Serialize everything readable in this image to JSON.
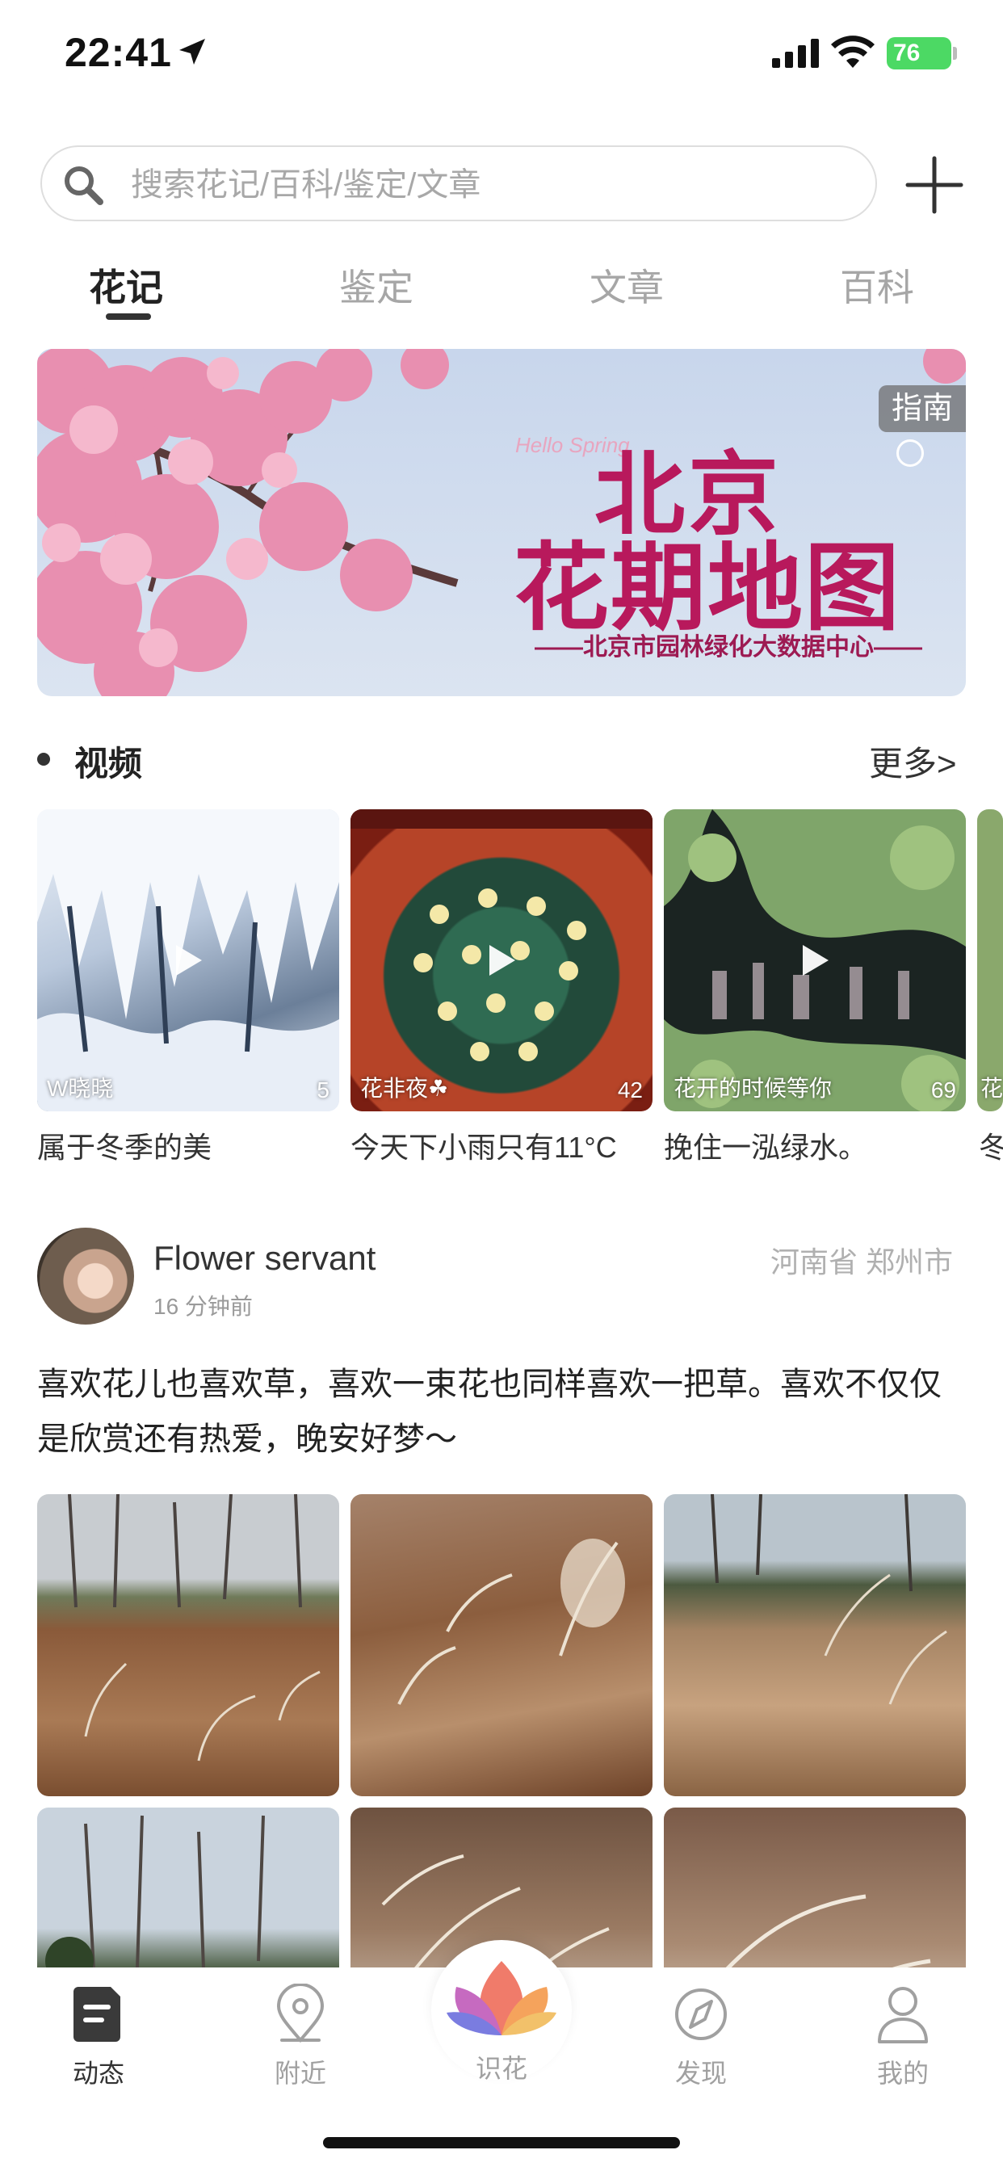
{
  "status_bar": {
    "time": "22:41",
    "battery": "76"
  },
  "search": {
    "placeholder": "搜索花记/百科/鉴定/文章"
  },
  "tabs": [
    {
      "label": "花记",
      "active": true
    },
    {
      "label": "鉴定",
      "active": false
    },
    {
      "label": "文章",
      "active": false
    },
    {
      "label": "百科",
      "active": false
    }
  ],
  "banner": {
    "tag": "指南",
    "hello": "Hello Spring",
    "title_line1": "北京",
    "title_line2": "花期地图",
    "subtitle": "——北京市园林绿化大数据中心——"
  },
  "video_section": {
    "title": "视频",
    "more": "更多>",
    "videos": [
      {
        "user": "W晓晓",
        "count": "5",
        "caption": "属于冬季的美"
      },
      {
        "user": "花非夜☘",
        "count": "42",
        "caption": "今天下小雨只有11°C"
      },
      {
        "user": "花开的时候等你",
        "count": "69",
        "caption": "挽住一泓绿水。"
      }
    ],
    "partial_card_user": "花",
    "partial_card_caption": "冬"
  },
  "post": {
    "author": "Flower servant",
    "time": "16 分钟前",
    "location": "河南省 郑州市",
    "text": "喜欢花儿也喜欢草，喜欢一束花也同样喜欢一把草。喜欢不仅仅是欣赏还有热爱，晚安好梦～"
  },
  "tab_bar": {
    "items": [
      {
        "label": "动态",
        "icon": "note-icon"
      },
      {
        "label": "附近",
        "icon": "location-pin-icon"
      },
      {
        "label": "识花",
        "icon": "lotus-icon"
      },
      {
        "label": "发现",
        "icon": "compass-icon"
      },
      {
        "label": "我的",
        "icon": "user-icon"
      }
    ]
  },
  "colors": {
    "banner_title": "#b8195c",
    "battery": "#4cd964",
    "inactive_tab": "#a6a6a6"
  }
}
